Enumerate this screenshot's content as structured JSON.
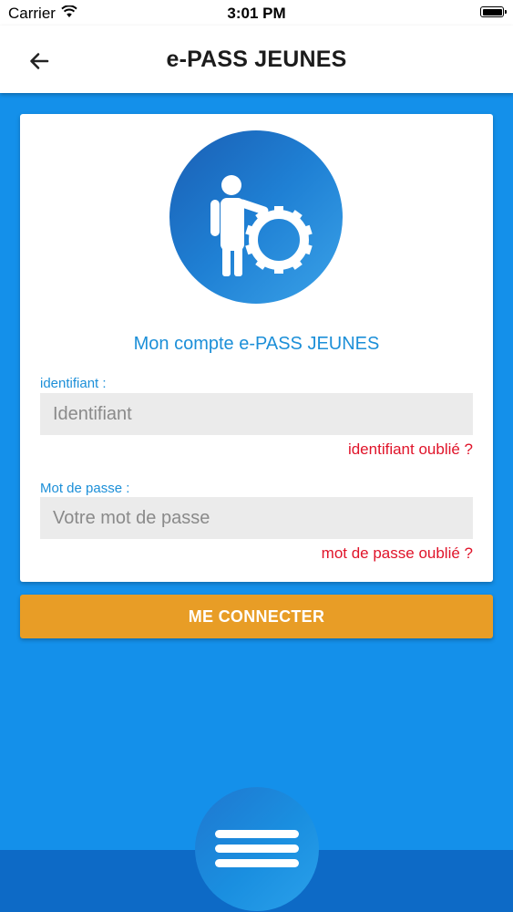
{
  "status_bar": {
    "carrier": "Carrier",
    "time": "3:01 PM"
  },
  "nav": {
    "title": "e-PASS JEUNES",
    "back_icon": "arrow-left-icon"
  },
  "card": {
    "title": "Mon compte e-PASS JEUNES",
    "avatar_icon": "person-gear-icon",
    "identifiant": {
      "label": "identifiant :",
      "value": "",
      "placeholder": "Identifiant",
      "forgot": "identifiant oublié ?"
    },
    "password": {
      "label": "Mot de passe :",
      "value": "",
      "placeholder": "Votre mot de passe",
      "forgot": "mot de passe oublié ?"
    }
  },
  "connect_button": {
    "label": "ME CONNECTER"
  },
  "menu": {
    "icon": "hamburger-menu-icon"
  },
  "colors": {
    "background": "#1490ea",
    "accent_text": "#1c8fd8",
    "link_red": "#e0142a",
    "button_orange": "#e89d26",
    "bottom_bar": "#0d6ac6"
  }
}
